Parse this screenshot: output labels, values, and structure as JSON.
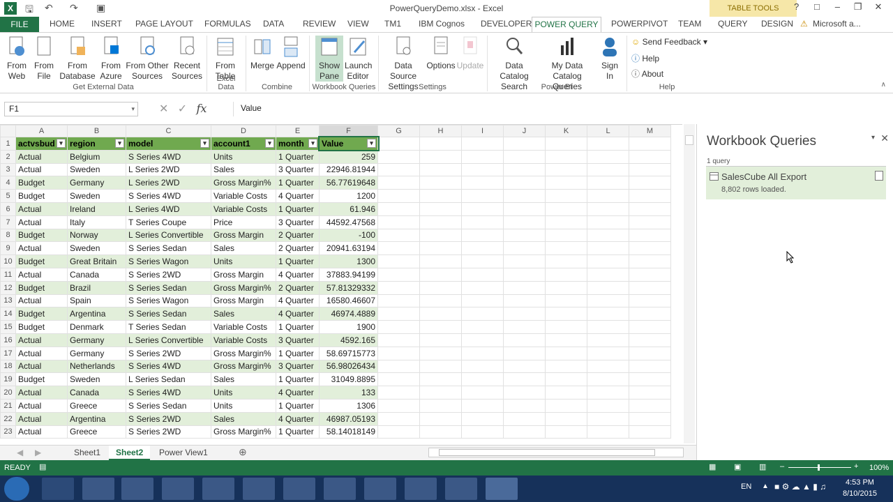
{
  "titlebar": {
    "document_title": "PowerQueryDemo.xlsx - Excel",
    "contextual_group": "TABLE TOOLS"
  },
  "tabs": {
    "file": "FILE",
    "items": [
      "HOME",
      "INSERT",
      "PAGE LAYOUT",
      "FORMULAS",
      "DATA",
      "REVIEW",
      "VIEW",
      "TM1",
      "IBM Cognos",
      "DEVELOPER",
      "POWER QUERY",
      "POWERPIVOT",
      "TEAM",
      "QUERY",
      "DESIGN"
    ],
    "active": "POWER QUERY",
    "account": "Microsoft a..."
  },
  "ribbon": {
    "get_external_data": {
      "label": "Get External Data",
      "buttons": [
        "From Web",
        "From File",
        "From Database",
        "From Azure",
        "From Other Sources",
        "Recent Sources"
      ]
    },
    "excel_data": {
      "label": "Excel Data",
      "buttons": [
        "From Table"
      ]
    },
    "combine": {
      "label": "Combine",
      "buttons": [
        "Merge",
        "Append"
      ]
    },
    "workbook_queries": {
      "label": "Workbook Queries",
      "buttons": [
        "Show Pane",
        "Launch Editor"
      ]
    },
    "settings": {
      "label": "Settings",
      "buttons": [
        "Data Source Settings",
        "Options",
        "Update"
      ]
    },
    "power_bi": {
      "label": "Power BI",
      "buttons": [
        "Data Catalog Search",
        "My Data Catalog Queries",
        "Sign In"
      ]
    },
    "help": {
      "label": "Help",
      "items": [
        "Send Feedback",
        "Help",
        "About"
      ]
    }
  },
  "formula_bar": {
    "name_box": "F1",
    "fx": "fx",
    "formula": "Value"
  },
  "sheet": {
    "columns": [
      "A",
      "B",
      "C",
      "D",
      "E",
      "F",
      "G",
      "H",
      "I",
      "J",
      "K",
      "L",
      "M"
    ],
    "headers": [
      "actvsbud",
      "region",
      "model",
      "account1",
      "month",
      "Value"
    ],
    "rows": [
      [
        "Actual",
        "Belgium",
        "S Series 4WD",
        "Units",
        "1 Quarter",
        "259"
      ],
      [
        "Actual",
        "Sweden",
        "L Series 2WD",
        "Sales",
        "3 Quarter",
        "22946.81944"
      ],
      [
        "Budget",
        "Germany",
        "L Series 2WD",
        "Gross Margin%",
        "1 Quarter",
        "56.77619648"
      ],
      [
        "Budget",
        "Sweden",
        "S Series 4WD",
        "Variable Costs",
        "4 Quarter",
        "1200"
      ],
      [
        "Actual",
        "Ireland",
        "L Series 4WD",
        "Variable Costs",
        "1 Quarter",
        "61.946"
      ],
      [
        "Actual",
        "Italy",
        "T Series Coupe",
        "Price",
        "3 Quarter",
        "44592.47568"
      ],
      [
        "Budget",
        "Norway",
        "L Series Convertible",
        "Gross Margin",
        "2 Quarter",
        "-100"
      ],
      [
        "Actual",
        "Sweden",
        "S Series Sedan",
        "Sales",
        "2 Quarter",
        "20941.63194"
      ],
      [
        "Budget",
        "Great Britain",
        "S Series Wagon",
        "Units",
        "1 Quarter",
        "1300"
      ],
      [
        "Actual",
        "Canada",
        "S Series 2WD",
        "Gross Margin",
        "4 Quarter",
        "37883.94199"
      ],
      [
        "Budget",
        "Brazil",
        "S Series Sedan",
        "Gross Margin%",
        "2 Quarter",
        "57.81329332"
      ],
      [
        "Actual",
        "Spain",
        "S Series Wagon",
        "Gross Margin",
        "4 Quarter",
        "16580.46607"
      ],
      [
        "Budget",
        "Argentina",
        "S Series Sedan",
        "Sales",
        "4 Quarter",
        "46974.4889"
      ],
      [
        "Budget",
        "Denmark",
        "T Series Sedan",
        "Variable Costs",
        "1 Quarter",
        "1900"
      ],
      [
        "Actual",
        "Germany",
        "L Series Convertible",
        "Variable Costs",
        "3 Quarter",
        "4592.165"
      ],
      [
        "Actual",
        "Germany",
        "S Series 2WD",
        "Gross Margin%",
        "1 Quarter",
        "58.69715773"
      ],
      [
        "Actual",
        "Netherlands",
        "S Series 4WD",
        "Gross Margin%",
        "3 Quarter",
        "56.98026434"
      ],
      [
        "Budget",
        "Sweden",
        "L Series Sedan",
        "Sales",
        "1 Quarter",
        "31049.8895"
      ],
      [
        "Actual",
        "Canada",
        "S Series 4WD",
        "Units",
        "4 Quarter",
        "133"
      ],
      [
        "Actual",
        "Greece",
        "S Series Sedan",
        "Units",
        "1 Quarter",
        "1306"
      ],
      [
        "Actual",
        "Argentina",
        "S Series 2WD",
        "Sales",
        "4 Quarter",
        "46987.05193"
      ],
      [
        "Actual",
        "Greece",
        "S Series 2WD",
        "Gross Margin%",
        "1 Quarter",
        "58.14018149"
      ]
    ]
  },
  "sheet_tabs": [
    "Sheet1",
    "Sheet2",
    "Power View1"
  ],
  "active_sheet": "Sheet2",
  "queries_pane": {
    "title": "Workbook Queries",
    "count": "1 query",
    "query_name": "SalesCube All Export",
    "query_status": "8,802 rows loaded."
  },
  "status": {
    "ready": "READY",
    "zoom": "100%"
  },
  "taskbar": {
    "language": "EN",
    "time": "4:53 PM",
    "date": "8/10/2015"
  },
  "colors": {
    "excel_green": "#217346",
    "table_header": "#70a94f",
    "band": "#e2efda",
    "taskbar": "#16315a"
  }
}
